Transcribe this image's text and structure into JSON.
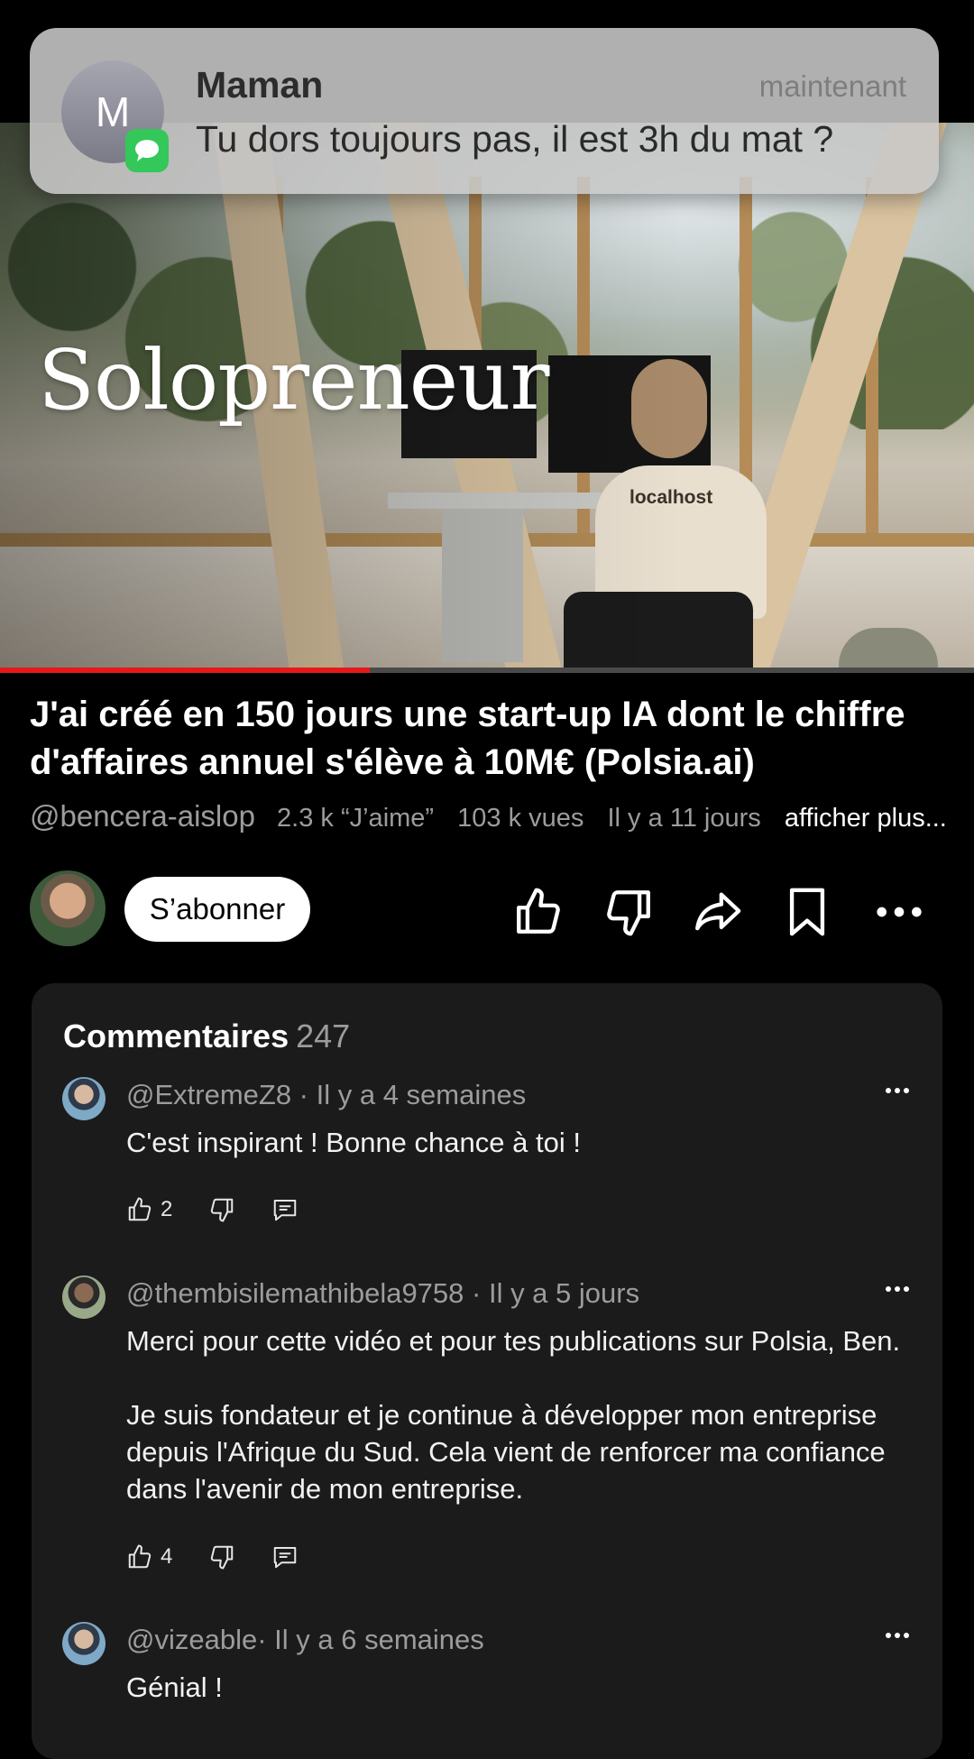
{
  "notification": {
    "avatar_letter": "M",
    "sender": "Maman",
    "time": "maintenant",
    "message": "Tu dors toujours pas, il est 3h du mat ?",
    "app_icon": "messages-icon"
  },
  "video": {
    "overlay_title": "Solopreneur",
    "shirt_text": "localhost",
    "progress": 0.38
  },
  "info": {
    "title": "J'ai créé en 150 jours une start-up IA dont le chiffre d'affaires annuel s'élève à 10M€ (Polsia.ai)",
    "handle": "@bencera-aislop",
    "likes": "2.3 k “J’aime”",
    "views": "103 k vues",
    "age": "Il y a 11 jours",
    "more": "afficher plus..."
  },
  "actions": {
    "subscribe": "S’abonner",
    "icons": [
      "like-icon",
      "dislike-icon",
      "share-icon",
      "save-icon",
      "more-icon"
    ]
  },
  "comments": {
    "header": "Commentaires",
    "count": "247",
    "items": [
      {
        "author": "@ExtremeZ8 · Il y a 4 semaines",
        "text": "C'est inspirant ! Bonne chance à toi !",
        "likes": "2"
      },
      {
        "author": "@thembisilemathibela9758 · Il y a 5 jours",
        "text": "Merci pour cette vidéo et pour tes publications sur Polsia, Ben.\n\nJe suis fondateur et je continue à développer mon entreprise depuis l'Afrique du Sud. Cela vient de renforcer ma confiance dans l'avenir de mon entreprise.",
        "likes": "4"
      },
      {
        "author": "@vizeable· Il y a 6 semaines",
        "text": "Génial !",
        "likes": ""
      }
    ]
  }
}
